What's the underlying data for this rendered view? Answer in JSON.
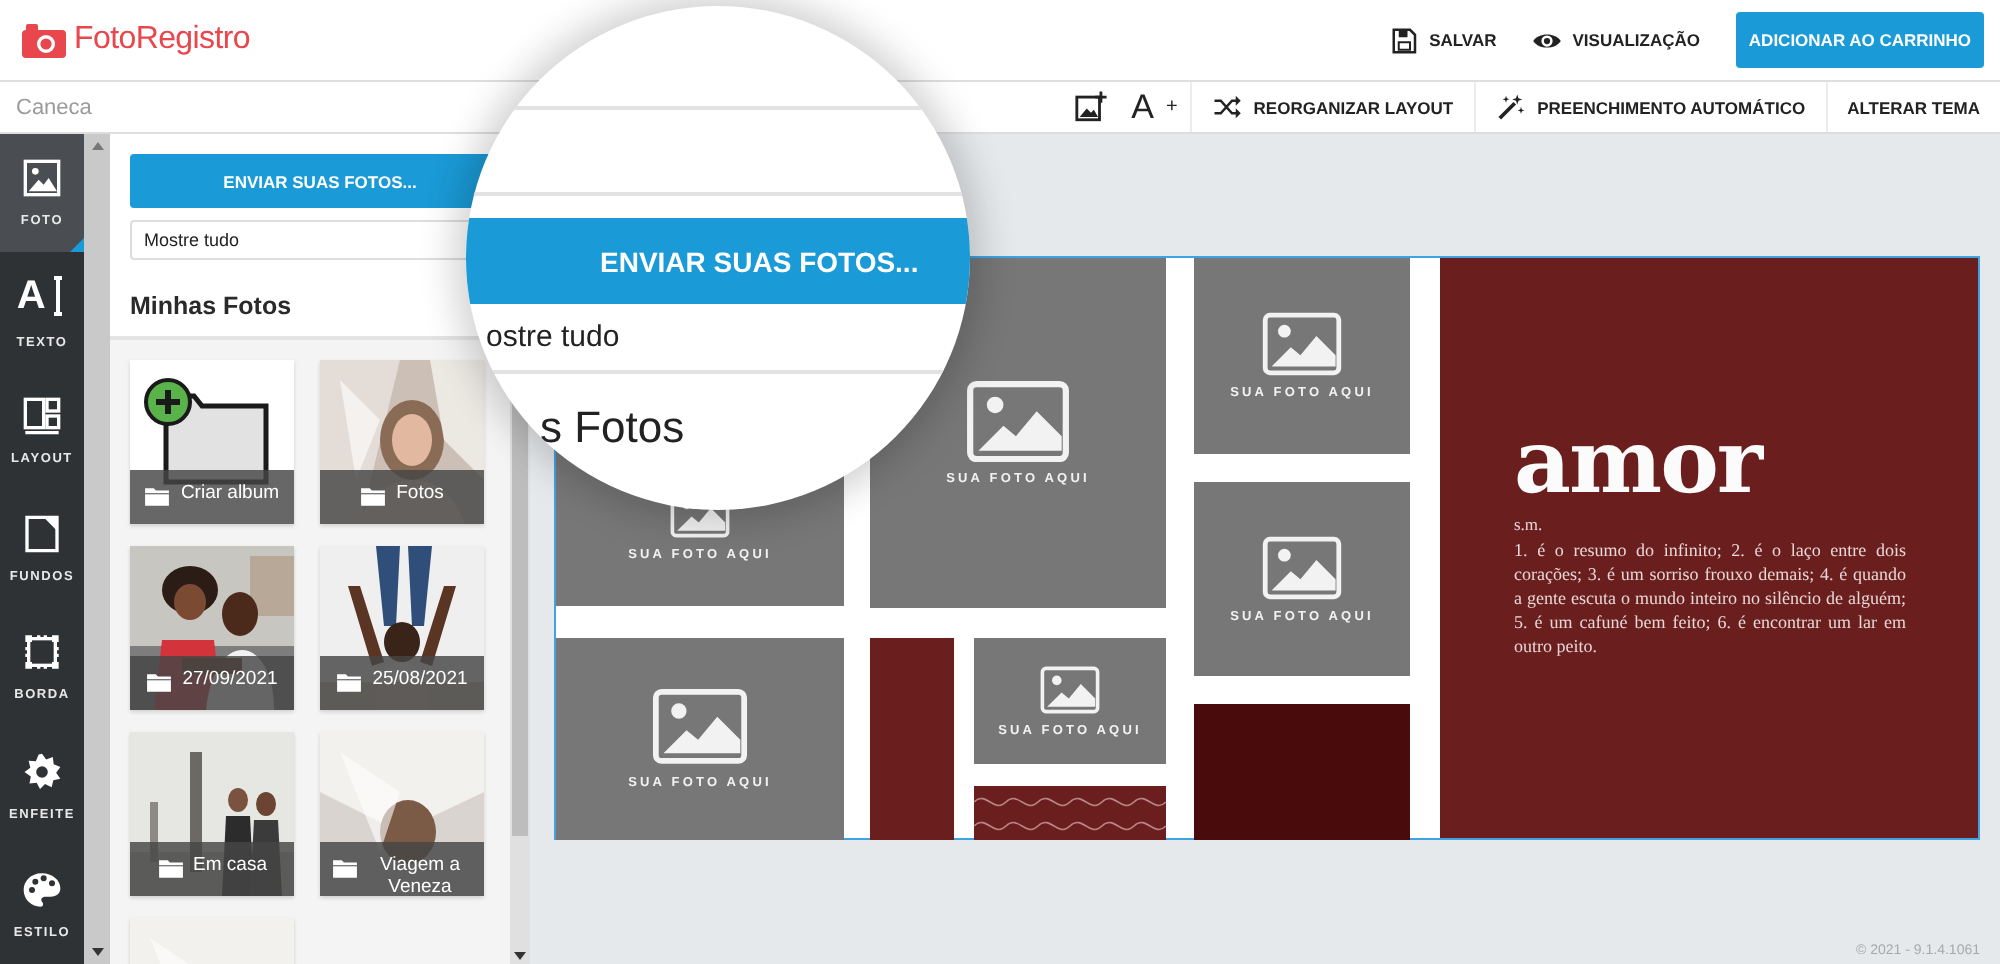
{
  "header": {
    "logo": "FotoRegistro",
    "actions": [
      "SALVAR",
      "VISUALIZAÇÃO"
    ],
    "cart_button": "ADICIONAR AO CARRINHO"
  },
  "toolbar": {
    "product": "Caneca",
    "tools": [
      {
        "kind": "icon"
      },
      {
        "kind": "glyph",
        "label": "A$^{+}$"
      },
      {
        "kind": "action",
        "label": "REORGANIZAR LAYOUT"
      },
      {
        "kind": "action",
        "label": "PREENCHIMENTO AUTOMÁTICO"
      },
      {
        "kind": "text",
        "label": "ALTERAR TEMA"
      }
    ]
  },
  "nav": [
    {
      "label": "FOTO",
      "selected": true
    },
    {
      "label": "TEXTO",
      "selected": false,
      "glyph": "A"
    },
    {
      "label": "LAYOUT",
      "selected": false
    },
    {
      "label": "FUNDOS",
      "selected": false
    },
    {
      "label": "BORDA",
      "selected": false
    },
    {
      "label": "ENFEITE",
      "selected": false
    },
    {
      "label": "ESTILO",
      "selected": false
    }
  ],
  "panel": {
    "upload_button": "ENVIAR SUAS FOTOS...",
    "filter": {
      "value": "Mostre tudo"
    },
    "title": "Minhas Fotos",
    "albums": [
      {
        "kind": "create",
        "label": "Criar album"
      },
      {
        "kind": "album",
        "label": "Fotos"
      },
      {
        "kind": "album",
        "label": "27/09/2021"
      },
      {
        "kind": "album",
        "label": "25/08/2021"
      },
      {
        "kind": "album",
        "label": "Em casa"
      },
      {
        "kind": "album",
        "label": "Viagem a Veneza"
      },
      {
        "kind": "album"
      }
    ]
  },
  "canvas": {
    "slots": [
      {
        "kind": "placeholder",
        "label": "SUA FOTO AQUI"
      },
      {
        "kind": "placeholder",
        "label": "SUA FOTO AQUI"
      },
      {
        "kind": "placeholder",
        "label": "SUA FOTO AQUI"
      },
      {
        "kind": "placeholder",
        "label": "SUA FOTO AQUI"
      },
      {
        "kind": "placeholder",
        "label": "SUA FOTO AQUI"
      },
      {
        "kind": "solid",
        "color": "#6a1e1e"
      },
      {
        "kind": "placeholder",
        "label": "SUA FOTO AQUI"
      },
      {
        "kind": "pattern",
        "color": "#6a1e1e"
      },
      {
        "kind": "solid",
        "color": "#4a0b0c"
      }
    ],
    "text_panel": {
      "title": "amor",
      "subtitle": "s.m.",
      "body": "1. é o resumo do infinito; 2. é o laço entre dois corações; 3. é um sorriso frouxo demais; 4. é quando a gente escuta o mundo inteiro no silêncio de alguém; 5. é um cafuné bem feito; 6. é encontrar um lar em outro peito."
    }
  },
  "magnifier": {
    "button": "ENVIAR SUAS FOTOS...",
    "filter": "ostre tudo",
    "title": "s Fotos"
  },
  "footer": {
    "version": "© 2021 - 9.1.4.1061"
  }
}
